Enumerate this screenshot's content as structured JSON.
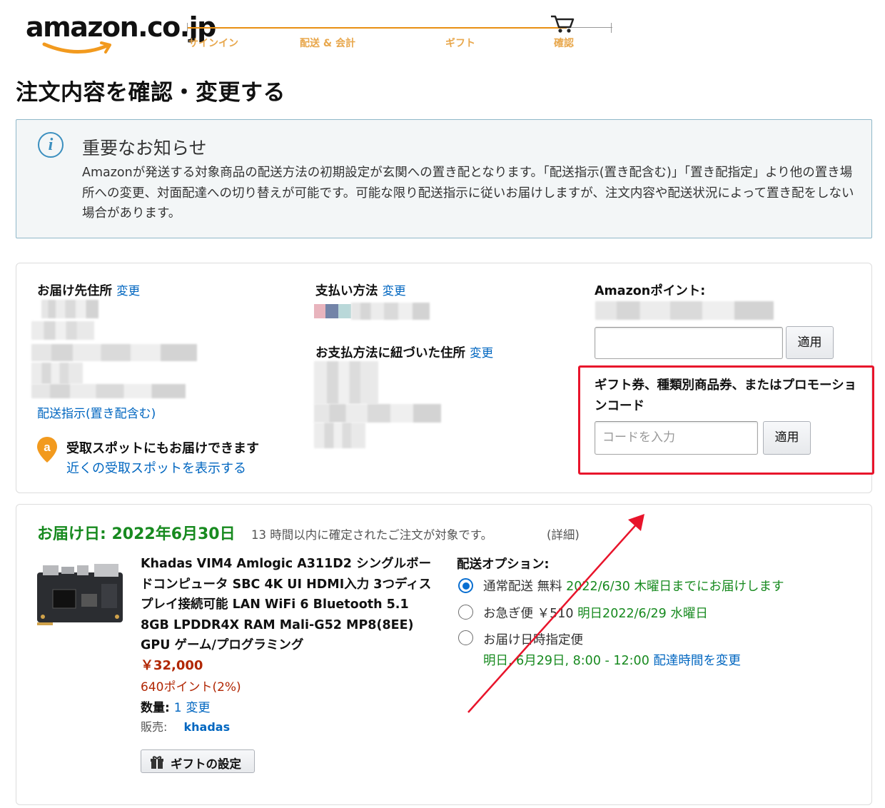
{
  "header": {
    "logo_text": "amazon.co.jp",
    "steps": [
      "サインイン",
      "配送 & 会計",
      "ギフト",
      "確認"
    ]
  },
  "page_title": "注文内容を確認・変更する",
  "notice": {
    "title": "重要なお知らせ",
    "body": "Amazonが発送する対象商品の配送方法の初期設定が玄関への置き配となります。「配送指示(置き配含む)」「置き配指定」より他の置き場所への変更、対面配達への切り替えが可能です。可能な限り配送指示に従いお届けしますが、注文内容や配送状況によって置き配をしない場合があります。"
  },
  "address": {
    "label": "お届け先住所",
    "change": "変更",
    "delivery_instructions_link": "配送指示(置き配含む)",
    "pickup_title": "受取スポットにもお届けできます",
    "pickup_link": "近くの受取スポットを表示する"
  },
  "payment": {
    "label": "支払い方法",
    "change": "変更",
    "billing_label": "お支払方法に紐づいた住所",
    "billing_change": "変更"
  },
  "points": {
    "label": "Amazonポイント:",
    "apply": "適用"
  },
  "promo": {
    "title": "ギフト券、種類別商品券、またはプロモーションコード",
    "placeholder": "コードを入力",
    "apply": "適用"
  },
  "delivery": {
    "date_label": "お届け日: 2022年6月30日",
    "note": "13 時間以内に確定されたご注文が対象です。",
    "detail_link": "(詳細)",
    "options_title": "配送オプション:",
    "options": [
      {
        "name": "通常配送",
        "price": "無料",
        "date": "2022/6/30 木曜日までにお届けします",
        "selected": true
      },
      {
        "name": "お急ぎ便",
        "price": "￥510",
        "date": "明日2022/6/29 水曜日",
        "selected": false
      },
      {
        "name": "お届け日時指定便",
        "price": "",
        "date": "明日, 6月29日, 8:00 - 12:00",
        "change_link": "配達時間を変更",
        "selected": false
      }
    ]
  },
  "product": {
    "title": "Khadas VIM4 Amlogic A311D2 シングルボードコンピュータ SBC 4K UI HDMI入力 3つディスプレイ接続可能 LAN WiFi 6 Bluetooth 5.1 8GB LPDDR4X RAM Mali-G52 MP8(8EE) GPU ゲーム/プログラミング",
    "price": "￥32,000",
    "points": "640ポイント(2%)",
    "qty_label": "数量:",
    "qty_value": "1",
    "qty_change": "変更",
    "seller_label": "販売:",
    "seller_name": "khadas",
    "gift_button": "ギフトの設定"
  },
  "colors": {
    "accent_orange": "#e88f13",
    "link_blue": "#0066c0",
    "delivery_green": "#178a1f",
    "price_red": "#b12704",
    "annotation_red": "#e8142b"
  }
}
